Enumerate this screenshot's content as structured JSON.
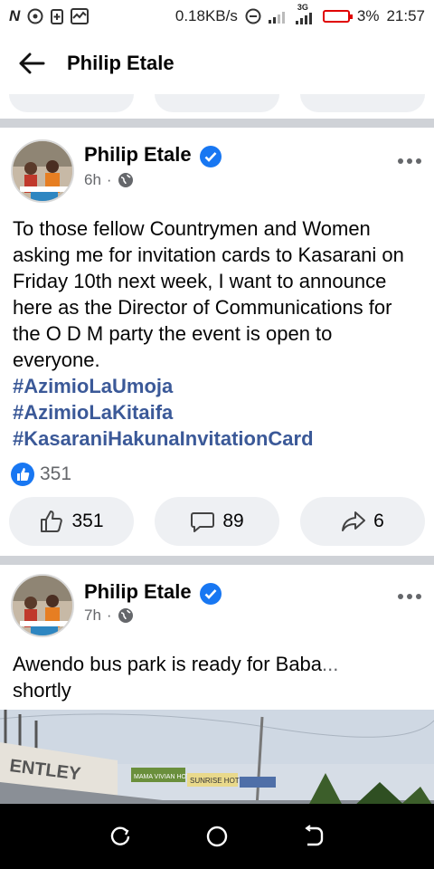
{
  "status_bar": {
    "network_speed": "0.18KB/s",
    "network_type": "3G",
    "battery": "3%",
    "time": "21:57",
    "icons": [
      "n-icon",
      "whatsapp-icon",
      "battery-saver-icon",
      "activity-icon",
      "dnd-icon",
      "signal-icon"
    ]
  },
  "header": {
    "title": "Philip Etale",
    "back_icon": "arrow-left-icon"
  },
  "posts": [
    {
      "author": "Philip Etale",
      "verified": true,
      "time": "6h",
      "privacy_icon": "globe-icon",
      "text": "To those fellow Countrymen and Women asking me for invitation cards to Kasarani on Friday 10th next week, I want to announce here as the Director of Communications for the O D M party the event is open to everyone.",
      "hashtags": [
        "#AzimioLaUmoja",
        "#AzimioLaKitaifa",
        "#KasaraniHakunaInvitationCard"
      ],
      "reaction_count": "351",
      "actions": {
        "like_count": "351",
        "comment_count": "89",
        "share_count": "6"
      }
    },
    {
      "author": "Philip Etale",
      "verified": true,
      "time": "7h",
      "privacy_icon": "globe-icon",
      "text": "Awendo bus park is ready for Baba",
      "text_more": "...",
      "text_line2": "shortly"
    }
  ],
  "photo_signs": [
    "ENTLEY",
    "MAMA VIVIAN HOTEL",
    "SUNRISE HOTEL"
  ],
  "colors": {
    "accent": "#1877f2",
    "hashtag": "#3b5998",
    "separator": "#cfd2d7",
    "button_bg": "#eef0f3",
    "battery": "#e00000"
  }
}
